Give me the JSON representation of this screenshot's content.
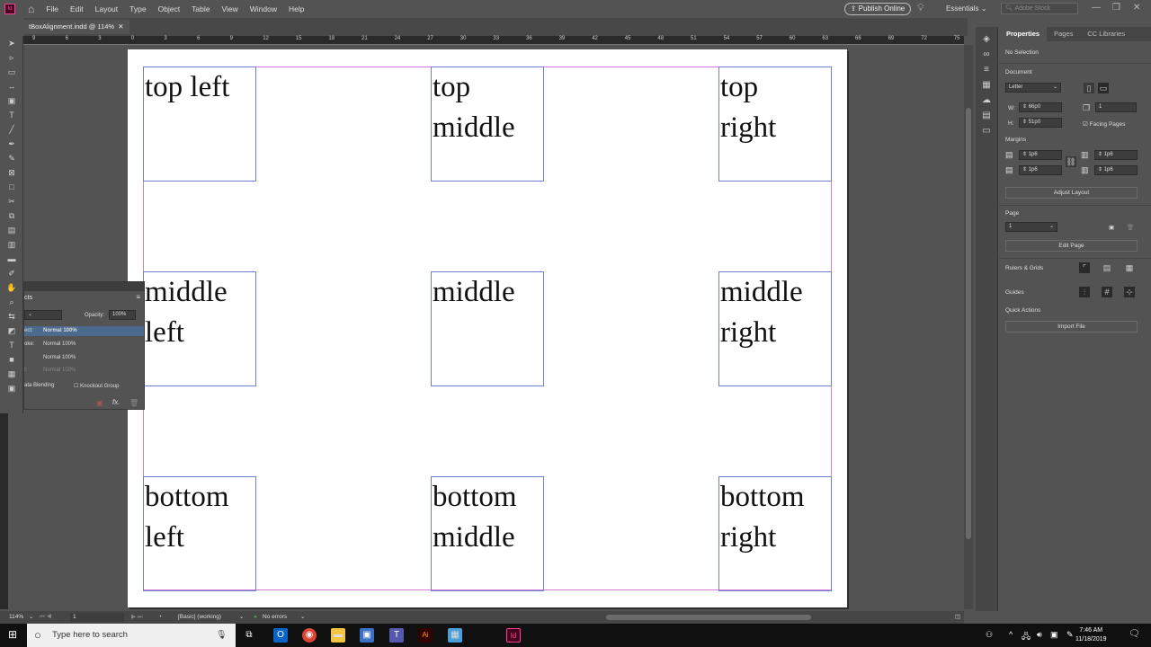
{
  "app": {
    "logo": "Id",
    "menu": [
      "File",
      "Edit",
      "Layout",
      "Type",
      "Object",
      "Table",
      "View",
      "Window",
      "Help"
    ],
    "publish": "Publish Online",
    "workspace": "Essentials",
    "stock_placeholder": "Adobe Stock"
  },
  "document": {
    "tab": "tBoxAlignment.indd @ 114%"
  },
  "ruler": {
    "ticks": [
      "9",
      "6",
      "3",
      "0",
      "3",
      "6",
      "9",
      "12",
      "15",
      "18",
      "21",
      "24",
      "27",
      "30",
      "33",
      "36",
      "39",
      "42",
      "45",
      "48",
      "51",
      "54",
      "57",
      "60",
      "63",
      "66",
      "69",
      "72",
      "75"
    ]
  },
  "frames": [
    {
      "text": "top left"
    },
    {
      "text": "top\nmiddle"
    },
    {
      "text": "top\nright"
    },
    {
      "text": "middle\nleft"
    },
    {
      "text": "middle"
    },
    {
      "text": "middle\nright"
    },
    {
      "text": "bottom\nleft"
    },
    {
      "text": "bottom\nmiddle"
    },
    {
      "text": "bottom\nright"
    }
  ],
  "effects": {
    "tab": "cts",
    "opacity_label": "Opacity:",
    "opacity": "100%",
    "rows": [
      {
        "label": "ect:",
        "value": "Normal 100%"
      },
      {
        "label": "oke:",
        "value": "Normal 100%"
      },
      {
        "label": "",
        "value": "Normal 100%"
      },
      {
        "label": "t:",
        "value": "Normal 100%"
      }
    ],
    "isolate": "ata Blending",
    "knockout": "Knockout Group"
  },
  "properties": {
    "tabs": [
      "Properties",
      "Pages",
      "CC Libraries"
    ],
    "selection": "No Selection",
    "document_label": "Document",
    "preset": "Letter",
    "w_label": "W:",
    "width": "66p0",
    "h_label": "H:",
    "height": "51p0",
    "pages": "1",
    "facing_pages": "Facing Pages",
    "facing_checked": true,
    "margins_label": "Margins",
    "margin_top": "1p6",
    "margin_bottom": "1p6",
    "margin_left": "1p6",
    "margin_right": "1p6",
    "adjust_layout": "Adjust Layout",
    "page_label": "Page",
    "page": "1",
    "edit_page": "Edit Page",
    "rulers_grids": "Rulers & Grids",
    "guides": "Guides",
    "quick_actions": "Quick Actions",
    "import_file": "Import File"
  },
  "status": {
    "zoom": "114%",
    "page": "1",
    "preflight_profile": "[Basic] (working)",
    "errors": "No errors",
    "ok_color": "#3cb043"
  },
  "taskbar": {
    "search_placeholder": "Type here to search",
    "time": "7:46 AM",
    "date": "11/18/2019"
  },
  "colors": {
    "margin_guide": "#d27bd2",
    "frame_edge": "#6f7fd0",
    "selection_row": "#4b6a8e"
  }
}
